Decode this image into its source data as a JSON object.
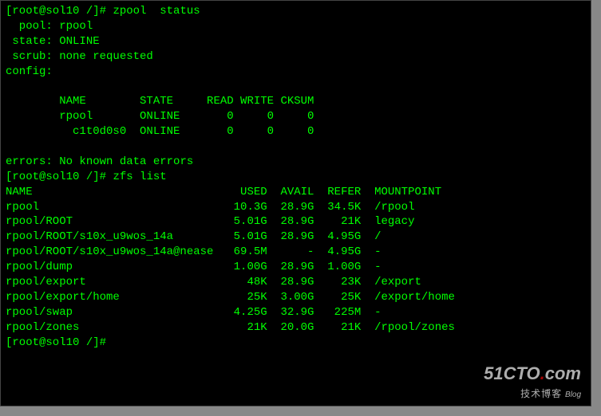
{
  "prompt1": {
    "user_host": "[root@sol10 /]#",
    "command": "zpool  status"
  },
  "zpool": {
    "pool_label": "  pool: ",
    "pool_value": "rpool",
    "state_label": " state: ",
    "state_value": "ONLINE",
    "scrub_label": " scrub: ",
    "scrub_value": "none requested",
    "config_label": "config:",
    "header": "        NAME        STATE     READ WRITE CKSUM",
    "row1": "        rpool       ONLINE       0     0     0",
    "row2": "          c1t0d0s0  ONLINE       0     0     0",
    "errors_label": "errors: ",
    "errors_value": "No known data errors"
  },
  "prompt2": {
    "user_host": "[root@sol10 /]#",
    "command": "zfs list"
  },
  "zfs": {
    "header": "NAME                               USED  AVAIL  REFER  MOUNTPOINT",
    "rows": [
      "rpool                             10.3G  28.9G  34.5K  /rpool",
      "rpool/ROOT                        5.01G  28.9G    21K  legacy",
      "rpool/ROOT/s10x_u9wos_14a         5.01G  28.9G  4.95G  /",
      "rpool/ROOT/s10x_u9wos_14a@nease   69.5M      -  4.95G  -",
      "rpool/dump                        1.00G  28.9G  1.00G  -",
      "rpool/export                        48K  28.9G    23K  /export",
      "rpool/export/home                   25K  3.00G    25K  /export/home",
      "rpool/swap                        4.25G  32.9G   225M  -",
      "rpool/zones                         21K  20.0G    21K  /rpool/zones"
    ]
  },
  "prompt3": {
    "user_host": "[root@sol10 /]#",
    "command": ""
  },
  "watermark": {
    "domain_main": "51CTO",
    "domain_dot": ".",
    "domain_tld": "com",
    "sub": "技术博客",
    "blog": "Blog"
  }
}
